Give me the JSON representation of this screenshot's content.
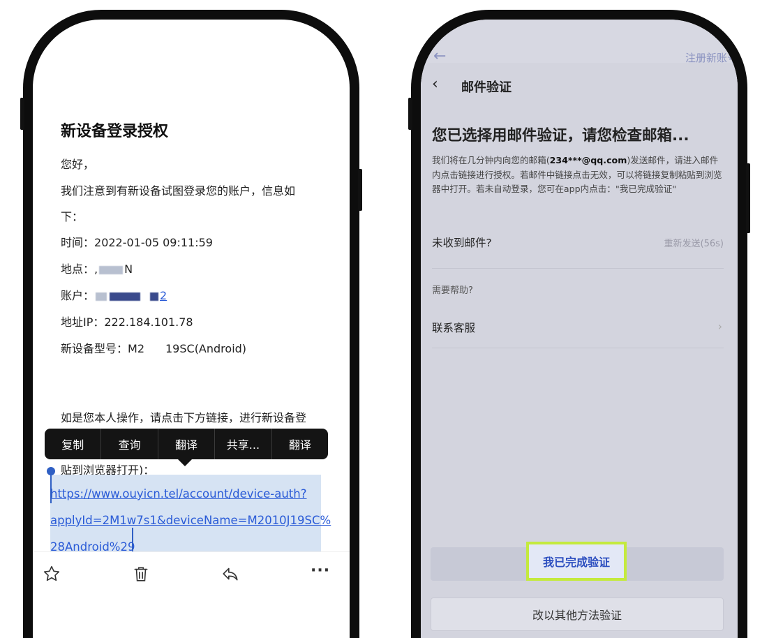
{
  "left": {
    "title": "新设备登录授权",
    "greeting": "您好，",
    "notice_line1": "我们注意到有新设备试图登录您的账户，信息如",
    "notice_line2": "下：",
    "time_label": "时间：",
    "time_value": "2022-01-05 09:11:59",
    "location_label": "地点：",
    "location_value": ",",
    "location_tail": "N",
    "account_label": "账户：",
    "account_tail": "2",
    "ip_label": "地址IP：",
    "ip_value": "222.184.101.78",
    "device_label": "新设备型号：",
    "device_head": "M2",
    "device_tail": "19SC(Android)",
    "instruction": "如是您本人操作，请点击下方链接，进行新设备登",
    "paste_hint": "贴到浏览器打开)：",
    "url_line1": "https://www.ouyicn.tel/account/device-auth?",
    "url_line2": "applyId=2M1w7s1&deviceName=M2010J19SC%",
    "url_line3": "28Android%29",
    "context_menu": [
      "复制",
      "查询",
      "翻译",
      "共享...",
      "翻译"
    ],
    "toolbar": {
      "star": "star-icon",
      "delete": "trash-icon",
      "reply": "reply-icon",
      "more": "···"
    }
  },
  "right": {
    "top_back": "←",
    "top_register": "注册新账号",
    "back": "‹",
    "title": "邮件验证",
    "heading": "您已选择用邮件验证，请您检查邮箱...",
    "desc_pre": "我们将在几分钟内向您的邮箱(",
    "desc_email": "234***@qq.com",
    "desc_post": ")发送邮件，请进入邮件内点击链接进行授权。若邮件中链接点击无效，可以将链接复制粘贴到浏览器中打开。若未自动登录，您可在app内点击：\"我已完成验证\"",
    "not_received": "未收到邮件?",
    "resend": "重新发送(56s)",
    "need_help": "需要帮助?",
    "contact": "联系客服",
    "chevron": "›",
    "btn_done": "我已完成验证",
    "btn_other": "改以其他方法验证"
  },
  "colors": {
    "link": "#2a5bd7",
    "highlight_border": "#c4ea3e",
    "button_text": "#2b4dbf"
  }
}
